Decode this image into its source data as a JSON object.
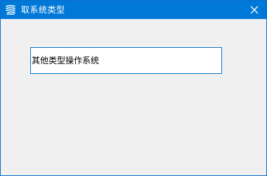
{
  "window": {
    "title": "取系统类型",
    "app_icon": "app-logo-icon",
    "close_icon": "close-icon"
  },
  "form": {
    "os_type_value": "其他类型操作系统"
  },
  "colors": {
    "titlebar": "#0078d7",
    "input_border": "#0a74c7",
    "background": "#f0f0f0"
  }
}
